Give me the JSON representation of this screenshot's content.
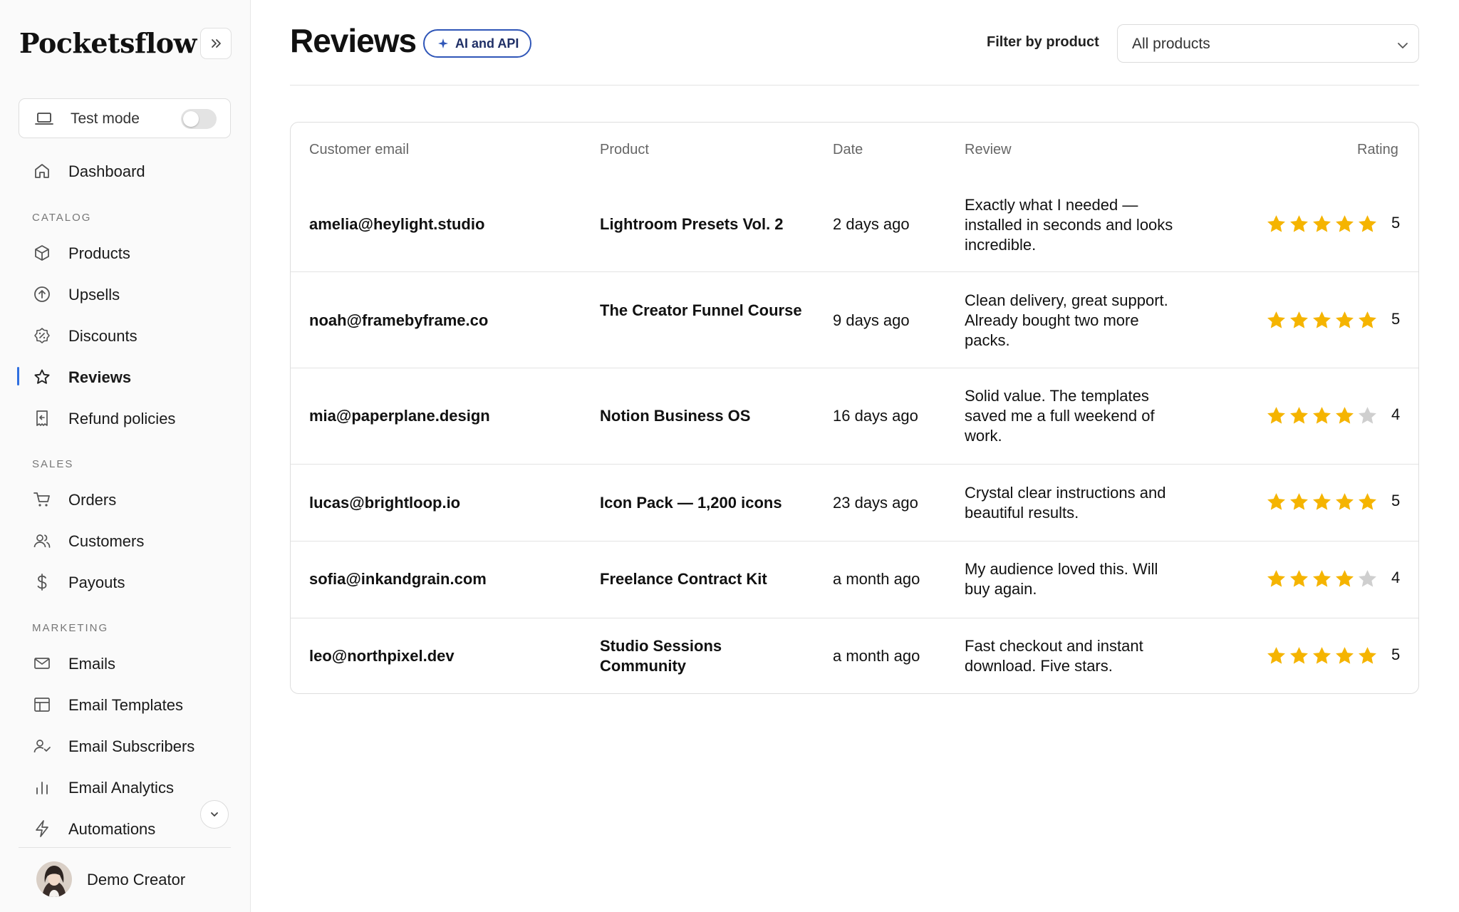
{
  "brand": "Pocketsflow",
  "sidebar": {
    "test_mode_label": "Test mode",
    "dashboard": "Dashboard",
    "catalog_label": "CATALOG",
    "catalog": [
      "Products",
      "Upsells",
      "Discounts",
      "Reviews",
      "Refund policies"
    ],
    "sales_label": "SALES",
    "sales": [
      "Orders",
      "Customers",
      "Payouts"
    ],
    "marketing_label": "MARKETING",
    "marketing": [
      "Emails",
      "Email Templates",
      "Email Subscribers",
      "Email Analytics",
      "Automations"
    ],
    "user_name": "Demo Creator"
  },
  "header": {
    "title": "Reviews",
    "badge": "AI and API",
    "filter_label": "Filter by product",
    "filter_value": "All products"
  },
  "table": {
    "columns": [
      "Customer email",
      "Product",
      "Date",
      "Review",
      "Rating"
    ],
    "rows": [
      {
        "email": "amelia@heylight.studio",
        "product": "Lightroom Presets Vol. 2",
        "date": "2 days ago",
        "review": "Exactly what I needed — installed in seconds and looks incredible.",
        "rating": "5"
      },
      {
        "email": "noah@framebyframe.co",
        "product": "The Creator Funnel Course",
        "date": "9 days ago",
        "review": "Clean delivery, great support. Already bought two more packs.",
        "rating": "5"
      },
      {
        "email": "mia@paperplane.design",
        "product": "Notion Business OS",
        "date": "16 days ago",
        "review": "Solid value. The templates saved me a full weekend of work.",
        "rating": "4"
      },
      {
        "email": "lucas@brightloop.io",
        "product": "Icon Pack — 1,200 icons",
        "date": "23 days ago",
        "review": "Crystal clear instructions and beautiful results.",
        "rating": "5"
      },
      {
        "email": "sofia@inkandgrain.com",
        "product": "Freelance Contract Kit",
        "date": "a month ago",
        "review": "My audience loved this. Will buy again.",
        "rating": "4"
      },
      {
        "email": "leo@northpixel.dev",
        "product": "Studio Sessions Community",
        "date": "a month ago",
        "review": "Fast checkout and instant download. Five stars.",
        "rating": "5"
      }
    ]
  },
  "colors": {
    "accent": "#2f6fe0",
    "star_filled": "#f5b400",
    "star_empty": "#cfcfcf",
    "badge_border": "#2f56b8"
  }
}
